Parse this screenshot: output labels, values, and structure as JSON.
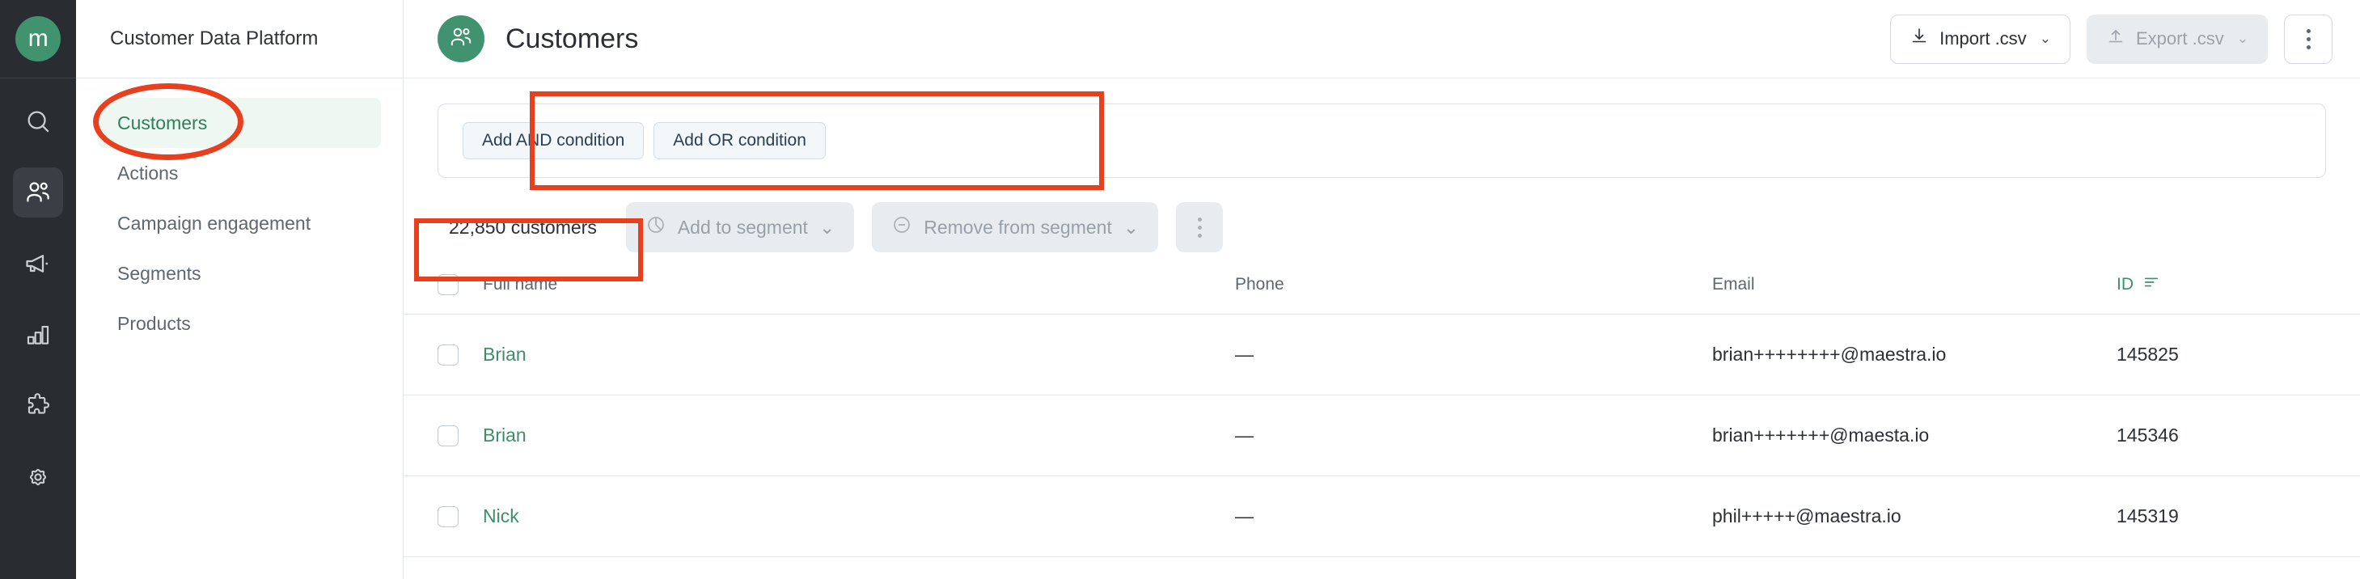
{
  "rail": {
    "logo_letter": "m",
    "items": [
      {
        "name": "search-icon",
        "label": "Search",
        "active": false
      },
      {
        "name": "users-icon",
        "label": "Customers",
        "active": true
      },
      {
        "name": "megaphone-icon",
        "label": "Campaigns",
        "active": false
      },
      {
        "name": "bar-chart-icon",
        "label": "Analytics",
        "active": false
      },
      {
        "name": "puzzle-icon",
        "label": "Integrations",
        "active": false
      },
      {
        "name": "gear-icon",
        "label": "Settings",
        "active": false
      }
    ]
  },
  "sidebar": {
    "header_title": "Customer Data Platform",
    "items": [
      {
        "label": "Customers",
        "active": true
      },
      {
        "label": "Actions",
        "active": false
      },
      {
        "label": "Campaign engagement",
        "active": false
      },
      {
        "label": "Segments",
        "active": false
      },
      {
        "label": "Products",
        "active": false
      }
    ]
  },
  "header": {
    "title": "Customers",
    "avatar_icon": "users-icon",
    "import_label": "Import .csv",
    "import_icon": "download-icon",
    "export_label": "Export .csv",
    "export_icon": "upload-icon",
    "chevron": "⌄",
    "more_icon": "kebab-menu-icon"
  },
  "filter": {
    "add_and_label": "Add AND condition",
    "add_or_label": "Add OR condition"
  },
  "toolbar": {
    "count_label": "22,850 customers",
    "add_to_segment_label": "Add to segment",
    "add_to_segment_icon": "segment-icon",
    "remove_from_segment_label": "Remove from segment",
    "remove_from_segment_icon": "minus-circle-icon",
    "chevron": "⌄",
    "more_icon": "kebab-menu-icon"
  },
  "table": {
    "columns": [
      "Full name",
      "Phone",
      "Email",
      "ID"
    ],
    "sorted_column": "ID",
    "sort_icon": "sort-descending-icon",
    "rows": [
      {
        "full_name": "Brian",
        "phone": "—",
        "email": "brian++++++++@maestra.io",
        "id": "145825"
      },
      {
        "full_name": "Brian",
        "phone": "—",
        "email": "brian+++++++@maesta.io",
        "id": "145346"
      },
      {
        "full_name": "Nick",
        "phone": "—",
        "email": "phil+++++@maestra.io",
        "id": "145319"
      }
    ]
  },
  "annotations": {
    "color": "#e8401f",
    "marks": [
      "sidebar-customers-ellipse",
      "filter-conditions-box",
      "customer-count-box"
    ]
  }
}
